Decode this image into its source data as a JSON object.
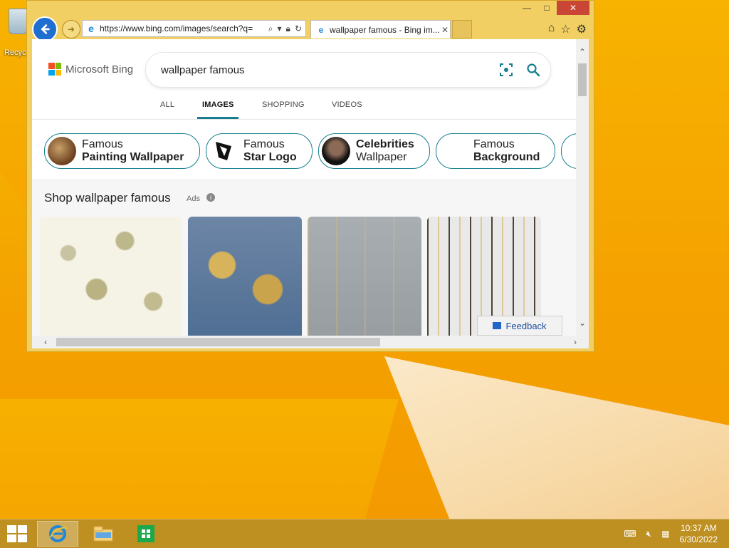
{
  "desktop": {
    "recycle_label": "Recyc"
  },
  "window": {
    "controls": {
      "minimize": "—",
      "maximize": "□",
      "close": "✕"
    },
    "address": {
      "url": "https://www.bing.com/images/search?q="
    },
    "tab": {
      "title": "wallpaper famous - Bing im...",
      "close": "✕"
    }
  },
  "bing": {
    "logo_text": "Microsoft Bing",
    "search_query": "wallpaper famous",
    "nav": [
      "ALL",
      "IMAGES",
      "SHOPPING",
      "VIDEOS"
    ],
    "chips": [
      {
        "line1": "Famous",
        "line2": "Painting Wallpaper",
        "bold_line": 2
      },
      {
        "line1": "Famous",
        "line2": "Star Logo",
        "bold_line": 2
      },
      {
        "line1": "Celebrities",
        "line2": "Wallpaper",
        "bold_line": 1
      },
      {
        "line1": "Famous",
        "line2": "Background",
        "bold_line": 2
      }
    ],
    "shop_title": "Shop wallpaper famous",
    "ads_label": "Ads",
    "info_icon": "i",
    "feedback_label": "Feedback"
  },
  "taskbar": {
    "time": "10:37 AM",
    "date": "6/30/2022"
  },
  "colors": {
    "bing_teal": "#167e8f",
    "window_frame": "#f2cf62",
    "close_red": "#c94536"
  }
}
